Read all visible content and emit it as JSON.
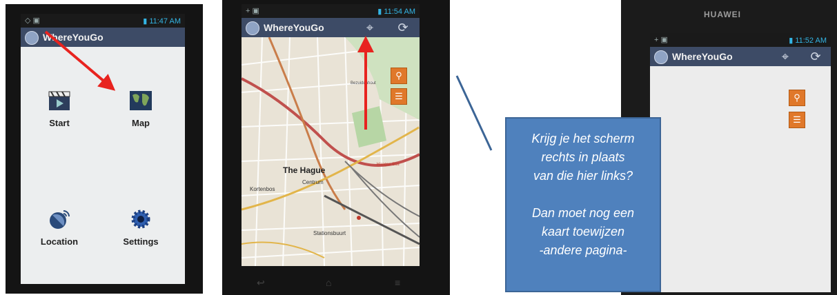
{
  "phone1": {
    "status_time": "11:47 AM",
    "app_title": "WhereYouGo",
    "tiles": [
      {
        "label": "Start",
        "icon": "film-clapper-icon"
      },
      {
        "label": "Map",
        "icon": "world-map-icon"
      },
      {
        "label": "Location",
        "icon": "satellite-dish-icon"
      },
      {
        "label": "Settings",
        "icon": "gear-icon"
      }
    ]
  },
  "phone2": {
    "status_time": "11:54 AM",
    "app_title": "WhereYouGo",
    "map_labels": {
      "city": "The Hague",
      "centrum": "Centrum",
      "kortenbos": "Kortenbos",
      "stationsbuurt": "Stationsbuurt",
      "bezuidenhout": "Bezuidenhout",
      "haagse_bos": "Haagse Bos"
    }
  },
  "phone3": {
    "brand": "HUAWEI",
    "status_time": "11:52 AM",
    "app_title": "WhereYouGo"
  },
  "callout": {
    "line1": "Krijg je het scherm",
    "line2": "rechts in plaats",
    "line3": "van die hier links?",
    "line4": "Dan moet nog een",
    "line5": "kaart toewijzen",
    "line6": "-andere pagina-"
  },
  "colors": {
    "appbar": "#3d4b66",
    "status_accent": "#33b5e5",
    "arrow_red": "#e8231f",
    "orange_button": "#e0782a",
    "callout_fill": "#4f81bd"
  }
}
